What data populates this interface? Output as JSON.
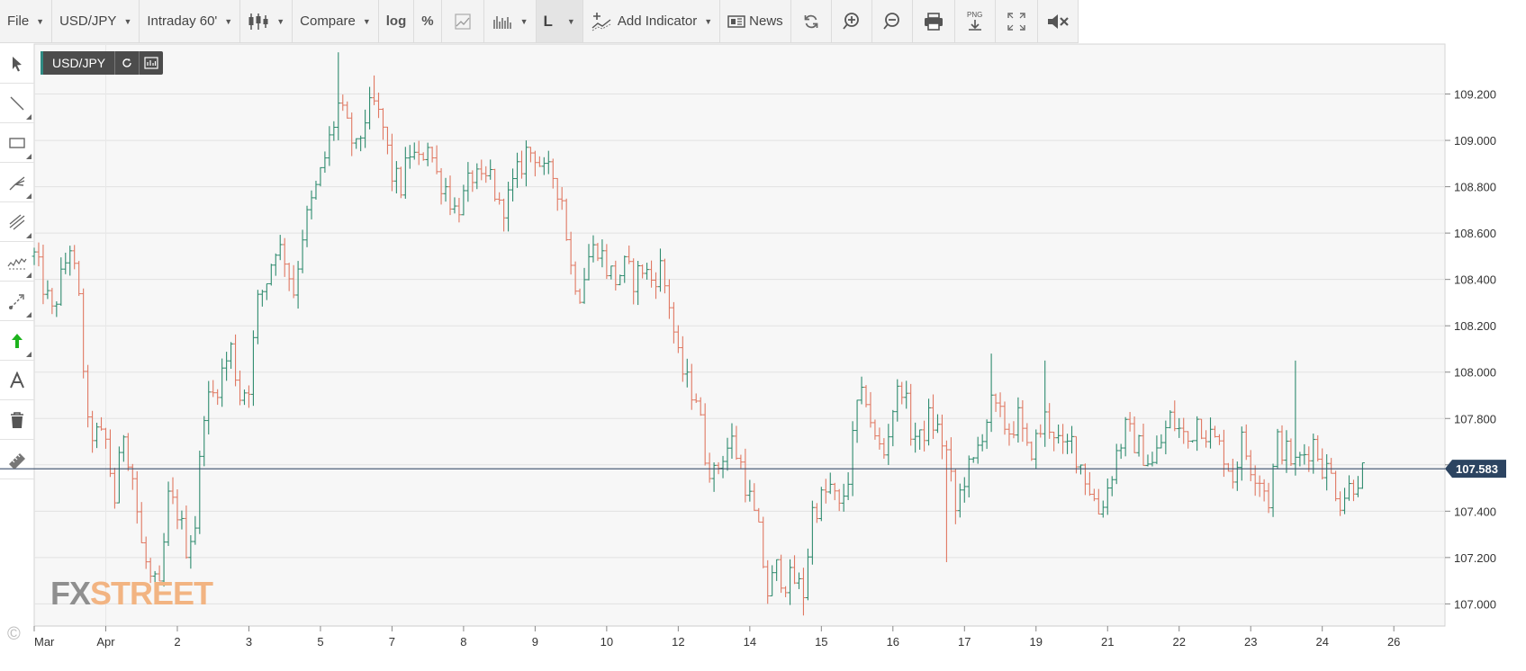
{
  "toolbar": {
    "file": "File",
    "symbol": "USD/JPY",
    "interval": "Intraday 60'",
    "compare": "Compare",
    "log": "log",
    "percent": "%",
    "chart_style": "L",
    "add_indicator": "Add Indicator",
    "news": "News",
    "png_label": "PNG"
  },
  "badge": {
    "symbol": "USD/JPY"
  },
  "watermark": {
    "part1": "FX",
    "part2": "STREET"
  },
  "copyright": "©",
  "colors": {
    "up": "#2e8b6e",
    "down": "#e07862",
    "price_line": "#3b4f6b",
    "price_badge": "#2c4461",
    "grid": "#e2e2e2",
    "plot_bg": "#f7f7f7"
  },
  "chart_data": {
    "type": "ohlc-bar",
    "series": "USD/JPY",
    "ylim": [
      106.92,
      109.4
    ],
    "y_ticks": [
      "109.200",
      "109.000",
      "108.800",
      "108.600",
      "108.400",
      "108.200",
      "108.000",
      "107.800",
      "107.600",
      "107.400",
      "107.200",
      "107.000"
    ],
    "x_ticks": [
      "Mar",
      "Apr",
      "2",
      "3",
      "5",
      "7",
      "8",
      "9",
      "10",
      "12",
      "14",
      "15",
      "16",
      "17",
      "19",
      "21",
      "22",
      "23",
      "24",
      "26"
    ],
    "x_tick_pos": [
      0,
      8,
      16,
      24,
      32,
      40,
      48,
      56,
      64,
      72,
      80,
      88,
      96,
      104,
      112,
      120,
      128,
      136,
      144,
      152
    ],
    "last_price": "107.583",
    "grid": true,
    "anchors": [
      [
        0,
        108.5
      ],
      [
        2,
        108.25
      ],
      [
        4,
        108.55
      ],
      [
        5,
        108.3
      ],
      [
        6,
        107.75
      ],
      [
        8,
        107.7
      ],
      [
        9,
        107.45
      ],
      [
        10,
        107.75
      ],
      [
        11,
        107.55
      ],
      [
        12,
        107.25
      ],
      [
        13,
        107.1
      ],
      [
        14,
        107.05
      ],
      [
        15,
        107.45
      ],
      [
        16,
        107.4
      ],
      [
        17,
        107.25
      ],
      [
        18,
        107.35
      ],
      [
        19,
        107.85
      ],
      [
        20,
        107.9
      ],
      [
        22,
        108.1
      ],
      [
        23,
        107.9
      ],
      [
        24,
        107.95
      ],
      [
        25,
        108.3
      ],
      [
        26,
        108.4
      ],
      [
        27,
        108.55
      ],
      [
        28,
        108.5
      ],
      [
        29,
        108.35
      ],
      [
        30,
        108.6
      ],
      [
        32,
        108.85
      ],
      [
        33,
        109.0
      ],
      [
        34,
        109.15
      ],
      [
        35,
        109.05
      ],
      [
        36,
        108.95
      ],
      [
        37,
        109.1
      ],
      [
        38,
        109.15
      ],
      [
        39,
        109.05
      ],
      [
        40,
        108.85
      ],
      [
        41,
        108.8
      ],
      [
        42,
        108.95
      ],
      [
        43,
        108.9
      ],
      [
        44,
        109.0
      ],
      [
        45,
        108.85
      ],
      [
        46,
        108.8
      ],
      [
        47,
        108.7
      ],
      [
        48,
        108.75
      ],
      [
        49,
        108.85
      ],
      [
        50,
        108.8
      ],
      [
        51,
        108.85
      ],
      [
        52,
        108.7
      ],
      [
        53,
        108.75
      ],
      [
        54,
        108.85
      ],
      [
        55,
        108.95
      ],
      [
        56,
        108.95
      ],
      [
        57,
        108.85
      ],
      [
        58,
        108.85
      ],
      [
        59,
        108.75
      ],
      [
        60,
        108.45
      ],
      [
        61,
        108.35
      ],
      [
        62,
        108.5
      ],
      [
        63,
        108.55
      ],
      [
        64,
        108.45
      ],
      [
        65,
        108.4
      ],
      [
        66,
        108.45
      ],
      [
        67,
        108.4
      ],
      [
        68,
        108.45
      ],
      [
        69,
        108.4
      ],
      [
        70,
        108.45
      ],
      [
        71,
        108.3
      ],
      [
        72,
        108.05
      ],
      [
        73,
        107.95
      ],
      [
        74,
        107.9
      ],
      [
        75,
        107.65
      ],
      [
        76,
        107.55
      ],
      [
        77,
        107.65
      ],
      [
        78,
        107.7
      ],
      [
        79,
        107.6
      ],
      [
        80,
        107.45
      ],
      [
        81,
        107.3
      ],
      [
        82,
        107.05
      ],
      [
        83,
        107.15
      ],
      [
        84,
        107.1
      ],
      [
        85,
        107.1
      ],
      [
        86,
        107.05
      ],
      [
        87,
        107.4
      ],
      [
        88,
        107.45
      ],
      [
        89,
        107.5
      ],
      [
        90,
        107.4
      ],
      [
        91,
        107.55
      ],
      [
        92,
        107.85
      ],
      [
        93,
        107.9
      ],
      [
        94,
        107.7
      ],
      [
        95,
        107.65
      ],
      [
        96,
        107.85
      ],
      [
        97,
        107.95
      ],
      [
        98,
        107.75
      ],
      [
        99,
        107.7
      ],
      [
        100,
        107.8
      ],
      [
        101,
        107.75
      ],
      [
        102,
        107.65
      ],
      [
        103,
        107.4
      ],
      [
        104,
        107.55
      ],
      [
        105,
        107.6
      ],
      [
        106,
        107.75
      ],
      [
        107,
        107.85
      ],
      [
        108,
        107.8
      ],
      [
        109,
        107.75
      ],
      [
        110,
        107.8
      ],
      [
        111,
        107.65
      ],
      [
        112,
        107.7
      ],
      [
        113,
        107.8
      ],
      [
        114,
        107.75
      ],
      [
        115,
        107.65
      ],
      [
        116,
        107.7
      ],
      [
        117,
        107.6
      ],
      [
        118,
        107.5
      ],
      [
        119,
        107.4
      ],
      [
        120,
        107.5
      ],
      [
        121,
        107.65
      ],
      [
        122,
        107.75
      ],
      [
        123,
        107.7
      ],
      [
        124,
        107.65
      ],
      [
        125,
        107.6
      ],
      [
        126,
        107.7
      ],
      [
        127,
        107.8
      ],
      [
        128,
        107.75
      ],
      [
        129,
        107.7
      ],
      [
        130,
        107.8
      ],
      [
        131,
        107.75
      ],
      [
        132,
        107.7
      ],
      [
        133,
        107.65
      ],
      [
        134,
        107.55
      ],
      [
        135,
        107.7
      ],
      [
        136,
        107.6
      ],
      [
        137,
        107.55
      ],
      [
        138,
        107.45
      ],
      [
        139,
        107.7
      ],
      [
        140,
        107.65
      ],
      [
        141,
        107.6
      ],
      [
        142,
        107.65
      ],
      [
        143,
        107.7
      ],
      [
        144,
        107.6
      ],
      [
        145,
        107.55
      ],
      [
        146,
        107.45
      ],
      [
        147,
        107.5
      ],
      [
        148,
        107.55
      ],
      [
        149,
        107.583
      ]
    ],
    "spikes": [
      [
        34,
        109.38
      ],
      [
        38,
        109.28
      ],
      [
        86,
        106.95
      ],
      [
        102,
        107.18
      ],
      [
        107,
        108.08
      ],
      [
        113,
        108.05
      ],
      [
        141,
        108.05
      ]
    ]
  }
}
